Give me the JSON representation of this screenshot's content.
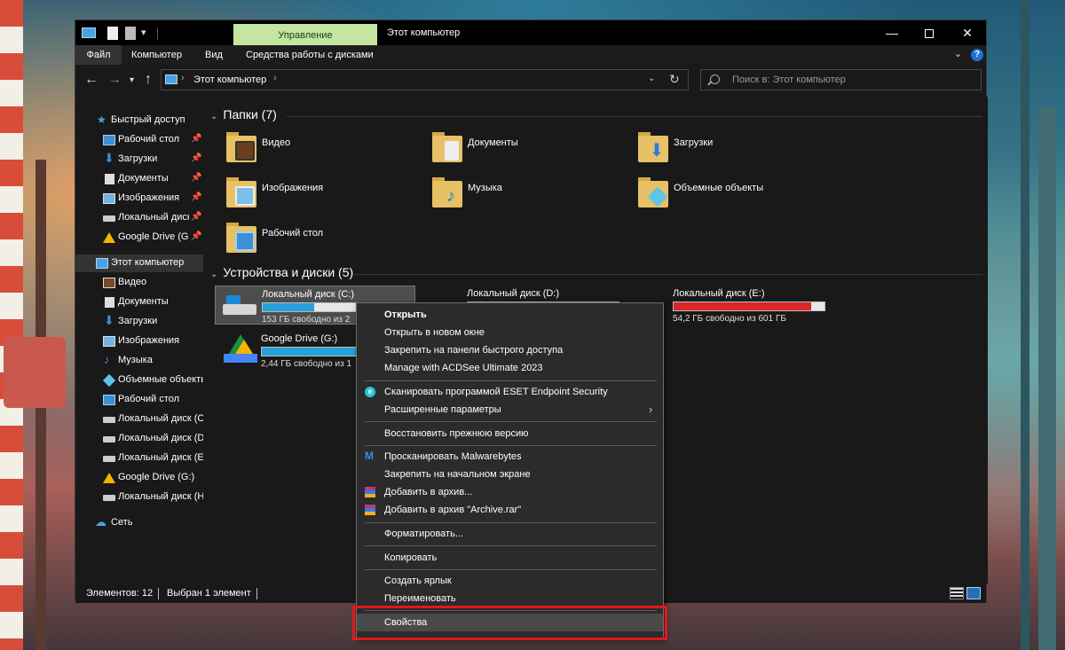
{
  "window": {
    "title": "Этот компьютер",
    "manage_tab": "Управление",
    "controls": {
      "minimize": "—",
      "close": "✕"
    }
  },
  "ribbon": {
    "tabs": [
      "Файл",
      "Компьютер",
      "Вид",
      "Средства работы с дисками"
    ],
    "help": "?"
  },
  "nav": {
    "address": "Этот компьютер",
    "search_placeholder": "Поиск в: Этот компьютер"
  },
  "sidebar": {
    "quick_access": "Быстрый доступ",
    "quick_items": [
      {
        "label": "Рабочий стол",
        "pinned": true
      },
      {
        "label": "Загрузки",
        "pinned": true
      },
      {
        "label": "Документы",
        "pinned": true
      },
      {
        "label": "Изображения",
        "pinned": true
      },
      {
        "label": "Локальный диск",
        "pinned": true
      },
      {
        "label": "Google Drive (G:)",
        "pinned": true
      }
    ],
    "this_pc": "Этот компьютер",
    "pc_items": [
      {
        "label": "Видео"
      },
      {
        "label": "Документы"
      },
      {
        "label": "Загрузки"
      },
      {
        "label": "Изображения"
      },
      {
        "label": "Музыка"
      },
      {
        "label": "Объемные объекты"
      },
      {
        "label": "Рабочий стол"
      },
      {
        "label": "Локальный диск (C:)"
      },
      {
        "label": "Локальный диск (D:)"
      },
      {
        "label": "Локальный диск (E:)"
      },
      {
        "label": "Google Drive (G:)"
      },
      {
        "label": "Локальный диск (H:)"
      }
    ],
    "network": "Сеть"
  },
  "content": {
    "folders_header": "Папки (7)",
    "folders": [
      {
        "label": "Видео",
        "icon": "video-folder-icon"
      },
      {
        "label": "Документы",
        "icon": "documents-folder-icon"
      },
      {
        "label": "Загрузки",
        "icon": "downloads-folder-icon"
      },
      {
        "label": "Изображения",
        "icon": "pictures-folder-icon"
      },
      {
        "label": "Музыка",
        "icon": "music-folder-icon"
      },
      {
        "label": "Объемные объекты",
        "icon": "3d-objects-folder-icon"
      },
      {
        "label": "Рабочий стол",
        "icon": "desktop-folder-icon"
      }
    ],
    "drives_header": "Устройства и диски (5)",
    "drives": [
      {
        "name": "Локальный диск (C:)",
        "free": "153 ГБ свободно из 2",
        "fill": 0.34,
        "color": "#26a0da"
      },
      {
        "name": "Локальный диск (D:)",
        "free": "",
        "fill": 0.79,
        "color": "#26a0da"
      },
      {
        "name": "Локальный диск (E:)",
        "free": "54,2 ГБ свободно из 601 ГБ",
        "fill": 0.91,
        "color": "#da2626"
      },
      {
        "name": "Google Drive (G:)",
        "free": "2,44 ГБ свободно из 1",
        "fill": 0.98,
        "color": "#26a0da"
      }
    ]
  },
  "status": {
    "items": "Элементов: 12",
    "selected": "Выбран 1 элемент"
  },
  "context_menu": {
    "items": [
      {
        "label": "Открыть",
        "bold": true
      },
      {
        "label": "Открыть в новом окне"
      },
      {
        "label": "Закрепить на панели быстрого доступа"
      },
      {
        "label": "Manage with ACDSee Ultimate 2023"
      },
      {
        "label": "Сканировать программой ESET Endpoint Security",
        "icon": "eset-icon"
      },
      {
        "label": "Расширенные параметры",
        "submenu": true
      },
      {
        "label": "Восстановить прежнюю версию"
      },
      {
        "label": "Просканировать Malwarebytes",
        "icon": "malwarebytes-icon"
      },
      {
        "label": "Закрепить на начальном экране"
      },
      {
        "label": "Добавить в архив...",
        "icon": "winrar-icon"
      },
      {
        "label": "Добавить в архив \"Archive.rar\"",
        "icon": "winrar-icon"
      },
      {
        "label": "Форматировать..."
      },
      {
        "label": "Копировать"
      },
      {
        "label": "Создать ярлык"
      },
      {
        "label": "Переименовать"
      },
      {
        "label": "Свойства",
        "highlighted": true
      }
    ],
    "highlight_color": "#e01919"
  }
}
